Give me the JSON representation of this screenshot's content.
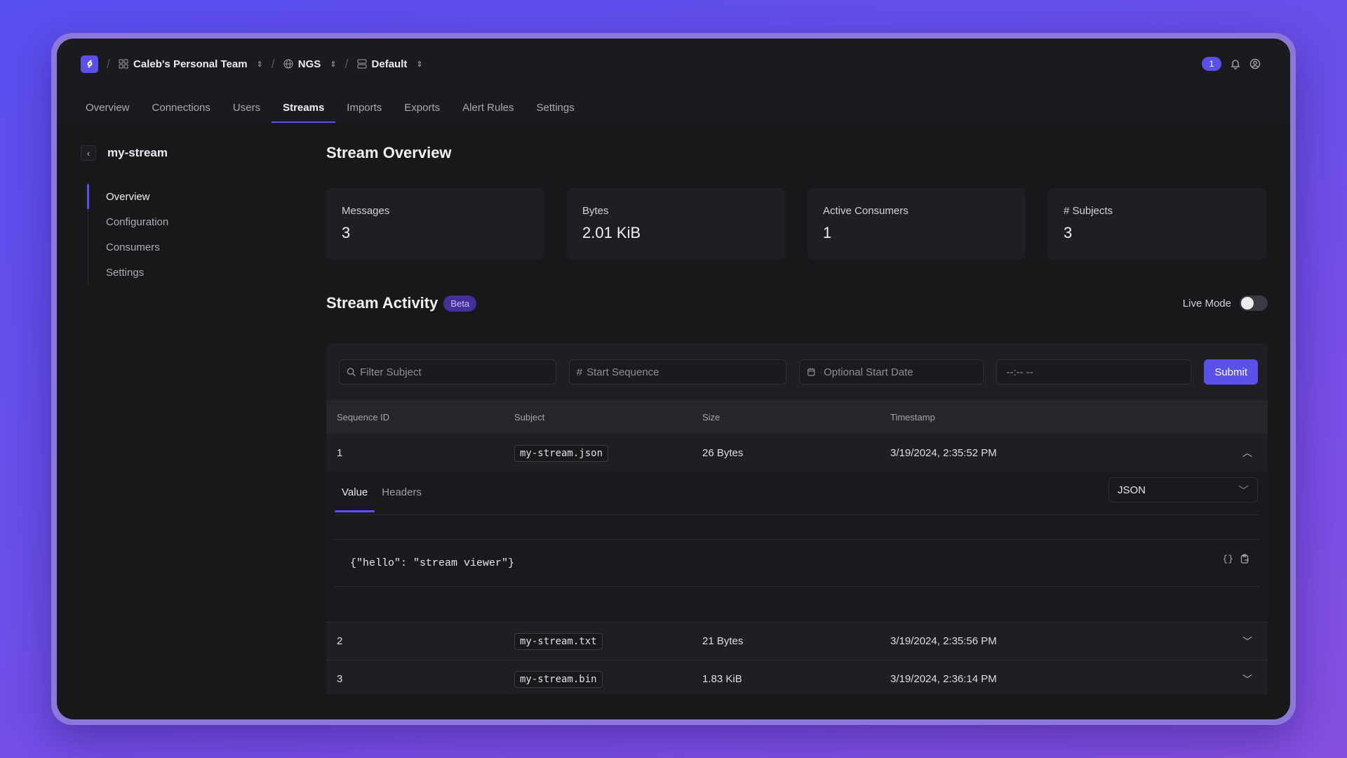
{
  "header": {
    "breadcrumbs": [
      {
        "label": "Caleb's Personal Team",
        "icon": "grid-icon"
      },
      {
        "label": "NGS",
        "icon": "globe-icon"
      },
      {
        "label": "Default",
        "icon": "server-icon"
      }
    ],
    "notification_count": "1"
  },
  "tabs": [
    {
      "label": "Overview",
      "active": false
    },
    {
      "label": "Connections",
      "active": false
    },
    {
      "label": "Users",
      "active": false
    },
    {
      "label": "Streams",
      "active": true
    },
    {
      "label": "Imports",
      "active": false
    },
    {
      "label": "Exports",
      "active": false
    },
    {
      "label": "Alert Rules",
      "active": false
    },
    {
      "label": "Settings",
      "active": false
    }
  ],
  "sidebar": {
    "stream_name": "my-stream",
    "back_icon": "chevron-left-icon",
    "items": [
      {
        "label": "Overview",
        "active": true
      },
      {
        "label": "Configuration",
        "active": false
      },
      {
        "label": "Consumers",
        "active": false
      },
      {
        "label": "Settings",
        "active": false
      }
    ]
  },
  "overview": {
    "title": "Stream Overview",
    "stats": [
      {
        "label": "Messages",
        "value": "3"
      },
      {
        "label": "Bytes",
        "value": "2.01 KiB"
      },
      {
        "label": "Active Consumers",
        "value": "1"
      },
      {
        "label": "# Subjects",
        "value": "3"
      }
    ]
  },
  "activity": {
    "title": "Stream Activity",
    "badge": "Beta",
    "live_mode_label": "Live Mode",
    "live_mode_on": false,
    "filters": {
      "subject_placeholder": "Filter Subject",
      "sequence_placeholder": "Start Sequence",
      "date_placeholder": "Optional Start Date",
      "time_value": "--:-- --",
      "submit_label": "Submit"
    },
    "columns": [
      "Sequence ID",
      "Subject",
      "Size",
      "Timestamp"
    ],
    "rows": [
      {
        "seq": "1",
        "subject": "my-stream.json",
        "size": "26 Bytes",
        "timestamp": "3/19/2024, 2:35:52 PM",
        "expanded": true
      },
      {
        "seq": "2",
        "subject": "my-stream.txt",
        "size": "21 Bytes",
        "timestamp": "3/19/2024, 2:35:56 PM",
        "expanded": false
      },
      {
        "seq": "3",
        "subject": "my-stream.bin",
        "size": "1.83 KiB",
        "timestamp": "3/19/2024, 2:36:14 PM",
        "expanded": false
      }
    ],
    "detail": {
      "tabs": [
        "Value",
        "Headers"
      ],
      "active_tab": "Value",
      "format": "JSON",
      "content": "{\"hello\": \"stream viewer\"}"
    }
  },
  "colors": {
    "accent": "#5b51e8",
    "background": "#18181b",
    "card": "#1f1f23"
  }
}
